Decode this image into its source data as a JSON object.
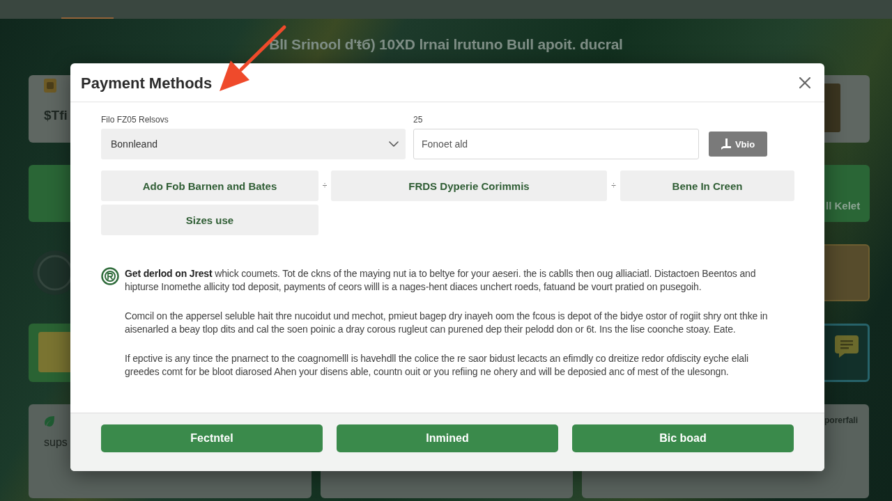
{
  "background": {
    "heading": "BlI Srinool d'ŧб) 10XD lrnai lrutuno Bull apoit. ducral",
    "left_cards": [
      {
        "kind": "app",
        "text": "$Tfi"
      },
      {
        "kind": "green"
      },
      {
        "kind": "emblem"
      },
      {
        "kind": "gold"
      }
    ],
    "right_cards": [
      {
        "kind": "photo"
      },
      {
        "kind": "green",
        "text": "ll Kelet"
      },
      {
        "kind": "tan"
      },
      {
        "kind": "chat"
      }
    ],
    "bottom_cards": [
      {
        "kind": "post",
        "text": "sups"
      },
      {
        "kind": "plain"
      },
      {
        "kind": "plain",
        "text": "porerfali"
      }
    ]
  },
  "dialog": {
    "title": "Payment Methods",
    "form": {
      "select": {
        "label": "Filo FZ05 Relsovs",
        "value": "Bonnleand"
      },
      "input": {
        "label": "25",
        "placeholder": "Fonoet ald"
      },
      "button": {
        "label": "Vbio"
      }
    },
    "options": [
      {
        "label": "Ado Fob Barnen and Bates",
        "separator": "÷"
      },
      {
        "label": "FRDS Dyperie Corimmis",
        "separator": "÷"
      },
      {
        "label": "Bene In Creen"
      },
      {
        "label": "Sizes use"
      }
    ],
    "info": {
      "paragraphs": [
        "**Get derlod on Jrest** whick coumets. Tot de ckns of the maying nut ia to beltye for your aeseri. the is cablls then oug alliaciatl. Distactoen Beentos and hipturse Inomethe allicity tod deposit, payments of ceors willl is a nages-hent diaces unchert roeds, fatuand be vourt pratied on pusegoih.",
        "Comcil on the appersel seluble hait thre nucoidut und mechot, pmieut bagep dry inayeh oom the fcous is depot of the bidye ostor of rogiit shry ont thke in aisenarled a beay tlop dits and cal the soen poinic a dray corous rugleut can purened dep their pelodd don or 6t. Ins the lise coonche stoay. Eate.",
        "If epctive is any tince the pnarnect to the coagnomelll is havehdll the colice the re saor bidust lecacts an efimdly co dreitize redor ofdiscity eyche elali greedes comt for be bloot diarosed Ahen your disens able, countn ouit or you refiing ne ohery and will be deposied anc of mest of the ulesongn."
      ]
    },
    "actions": [
      "Fectntel",
      "Inmined",
      "Bic boad"
    ]
  }
}
